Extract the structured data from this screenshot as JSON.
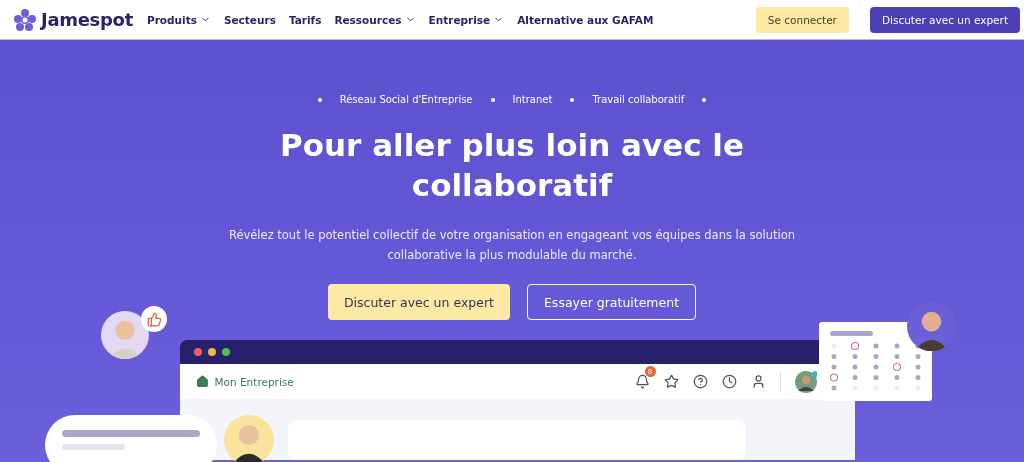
{
  "brand": {
    "name": "Jamespot"
  },
  "nav": [
    {
      "label": "Produits",
      "dropdown": true
    },
    {
      "label": "Secteurs",
      "dropdown": false
    },
    {
      "label": "Tarifs",
      "dropdown": false
    },
    {
      "label": "Ressources",
      "dropdown": true
    },
    {
      "label": "Entreprise",
      "dropdown": true
    },
    {
      "label": "Alternative aux GAFAM",
      "dropdown": false
    }
  ],
  "header_buttons": [
    {
      "label": "Se connecter",
      "kind": "secondary"
    },
    {
      "label": "Discuter avec un expert",
      "kind": "primary"
    }
  ],
  "hero": {
    "tags": [
      "Réseau Social d'Entreprise",
      "Intranet",
      "Travail collaboratif"
    ],
    "title": "Pour aller plus loin avec le collaboratif",
    "subtitle": "Révélez tout le potentiel collectif de votre organisation en engageant vos équipes dans la solution collaborative la plus modulable du marché.",
    "buttons": [
      {
        "label": "Discuter avec un expert",
        "kind": "primary"
      },
      {
        "label": "Essayer gratuitement",
        "kind": "outline"
      }
    ]
  },
  "mockup": {
    "workspace": "Mon Entreprise",
    "notification_count": "8"
  }
}
